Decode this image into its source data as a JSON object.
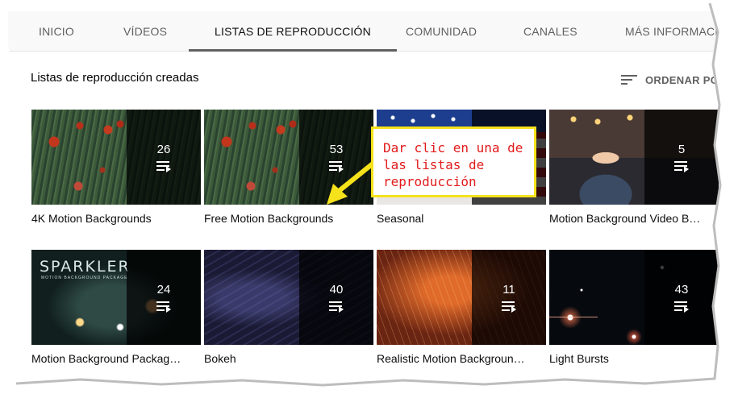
{
  "tabs": [
    {
      "label": "INICIO"
    },
    {
      "label": "VÍDEOS"
    },
    {
      "label": "LISTAS DE REPRODUCCIÓN",
      "active": true
    },
    {
      "label": "COMUNIDAD"
    },
    {
      "label": "CANALES"
    },
    {
      "label": "MÁS INFORMACIÓN"
    }
  ],
  "section": {
    "title": "Listas de reproducción creadas",
    "sort_label": "ORDENAR POR",
    "sort_icon": "sort-icon"
  },
  "playlists": [
    {
      "title": "4K Motion Backgrounds",
      "count": "26"
    },
    {
      "title": "Free Motion Backgrounds",
      "count": "53"
    },
    {
      "title": "Seasonal",
      "count": ""
    },
    {
      "title": "Motion Background Video B…",
      "count": "5"
    },
    {
      "title": "Motion Background Packag…",
      "count": "24",
      "thumb_text": "SPARKLER",
      "thumb_subtext": "MOTION BACKGROUND PACKAGE"
    },
    {
      "title": "Bokeh",
      "count": "40"
    },
    {
      "title": "Realistic Motion Backgroun…",
      "count": "11"
    },
    {
      "title": "Light Bursts",
      "count": "43"
    }
  ],
  "annotation": {
    "text_line1": "Dar clic en una de",
    "text_line2": "las listas de",
    "text_line3": "reproducción",
    "border_color": "#f5e21b",
    "text_color": "#e21b1b"
  }
}
